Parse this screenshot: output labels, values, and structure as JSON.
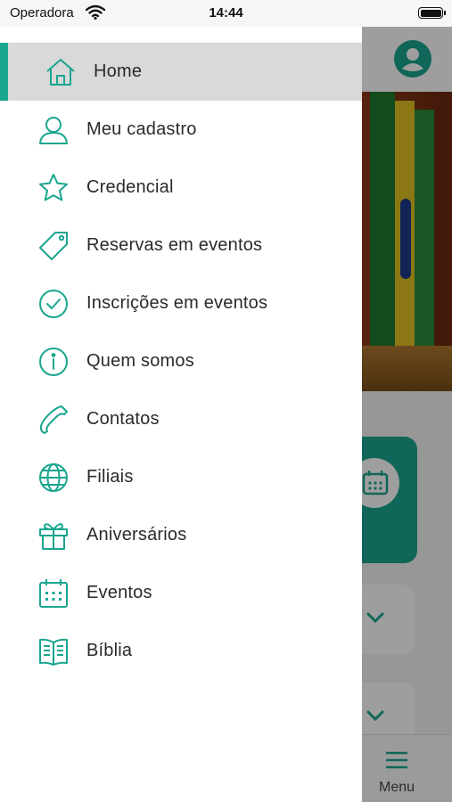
{
  "status_bar": {
    "carrier": "Operadora",
    "time": "14:44"
  },
  "colors": {
    "accent": "#1aa58f",
    "active_bg": "#d9d9d9",
    "text": "#2a2a2a"
  },
  "drawer": {
    "items": [
      {
        "label": "Home",
        "icon": "home-icon",
        "active": true
      },
      {
        "label": "Meu cadastro",
        "icon": "user-icon"
      },
      {
        "label": "Credencial",
        "icon": "star-icon"
      },
      {
        "label": "Reservas em eventos",
        "icon": "tag-icon"
      },
      {
        "label": "Inscrições em eventos",
        "icon": "check-circle-icon"
      },
      {
        "label": "Quem somos",
        "icon": "info-icon"
      },
      {
        "label": "Contatos",
        "icon": "phone-icon"
      },
      {
        "label": "Filiais",
        "icon": "globe-icon"
      },
      {
        "label": "Aniversários",
        "icon": "gift-icon"
      },
      {
        "label": "Eventos",
        "icon": "calendar-icon"
      },
      {
        "label": "Bíblia",
        "icon": "book-icon"
      }
    ]
  },
  "tab_bar": {
    "menu_label": "Menu"
  }
}
